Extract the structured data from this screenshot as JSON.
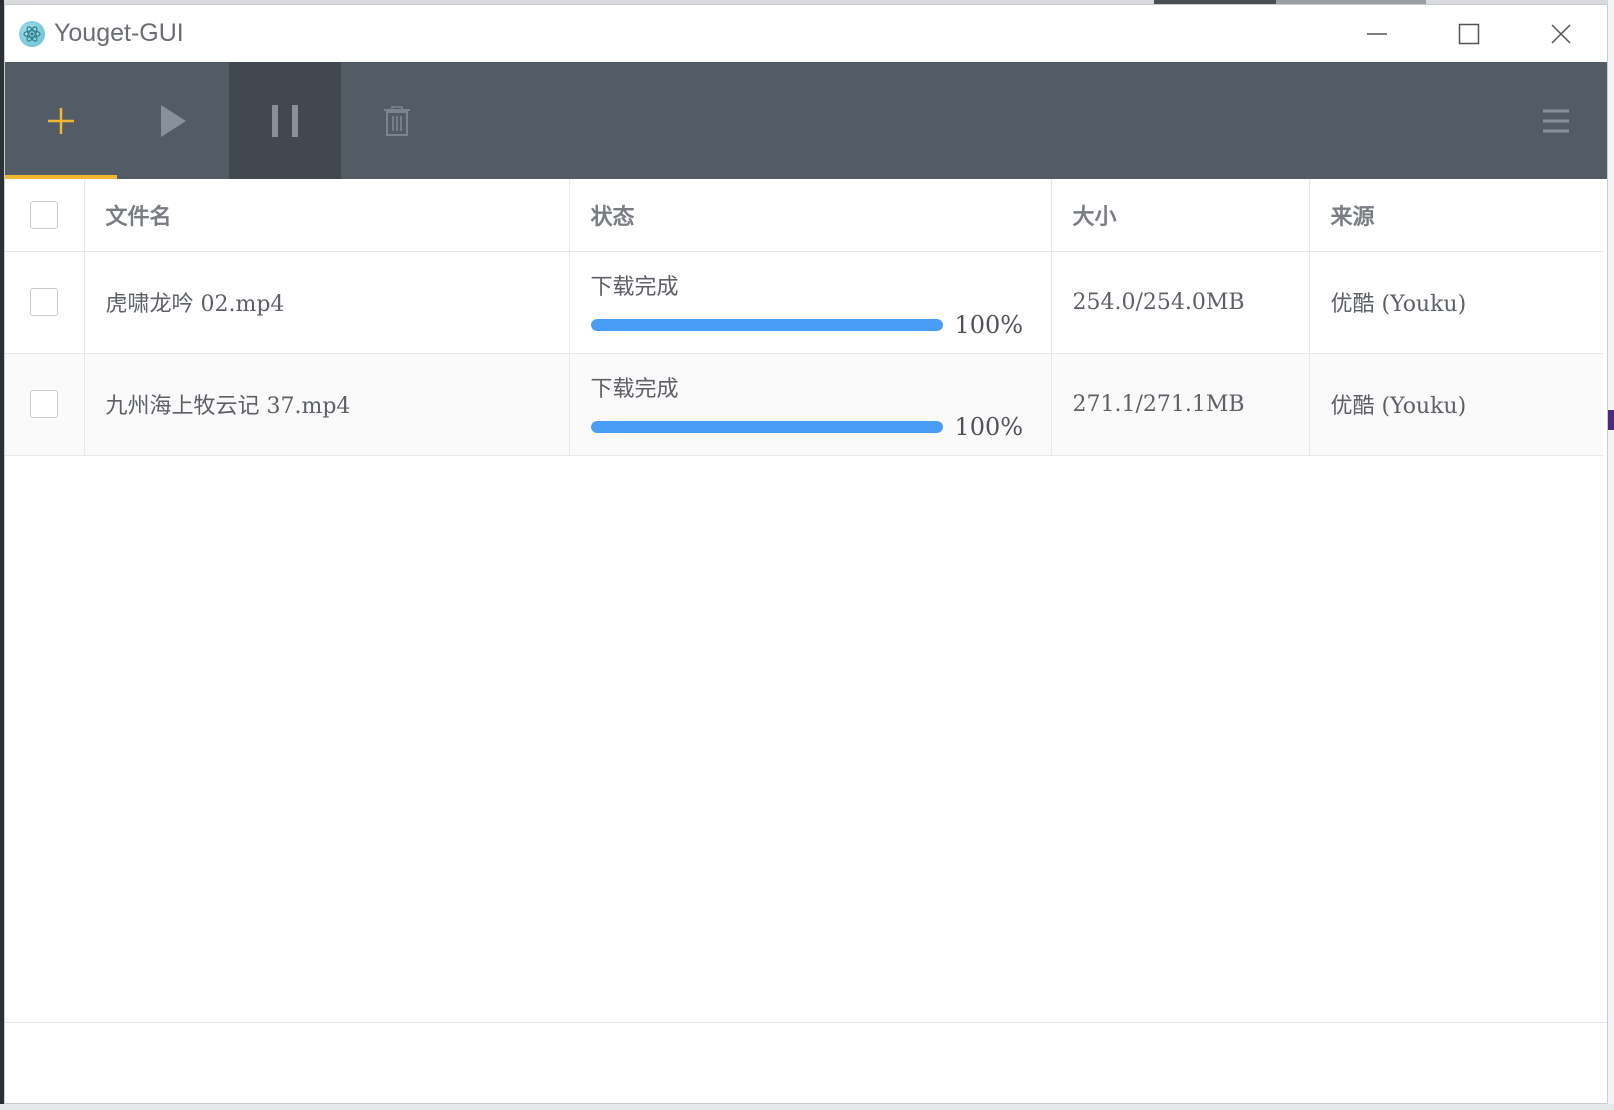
{
  "window": {
    "title": "Youget-GUI",
    "controls": {
      "minimize": "minimize-icon",
      "maximize": "maximize-icon",
      "close": "close-icon"
    }
  },
  "toolbar": {
    "buttons": [
      {
        "icon": "plus-icon",
        "color": "#f2b632",
        "active": true
      },
      {
        "icon": "play-icon",
        "color": "#8a9099"
      },
      {
        "icon": "pause-icon",
        "color": "#8a9099",
        "highlighted": true
      },
      {
        "icon": "trash-icon",
        "color": "#7c838c"
      }
    ],
    "menu_icon": "hamburger-menu-icon",
    "background": "#535b64",
    "accent": "#f2b632"
  },
  "table": {
    "headers": {
      "filename": "文件名",
      "status": "状态",
      "size": "大小",
      "source": "来源"
    },
    "rows": [
      {
        "filename": "虎啸龙吟 02.mp4",
        "status": "下载完成",
        "progress": 100,
        "progress_label": "100%",
        "size": "254.0/254.0MB",
        "source": "优酷 (Youku)"
      },
      {
        "filename": "九州海上牧云记 37.mp4",
        "status": "下载完成",
        "progress": 100,
        "progress_label": "100%",
        "size": "271.1/271.1MB",
        "source": "优酷 (Youku)"
      }
    ],
    "progress_color": "#4a9df4"
  }
}
